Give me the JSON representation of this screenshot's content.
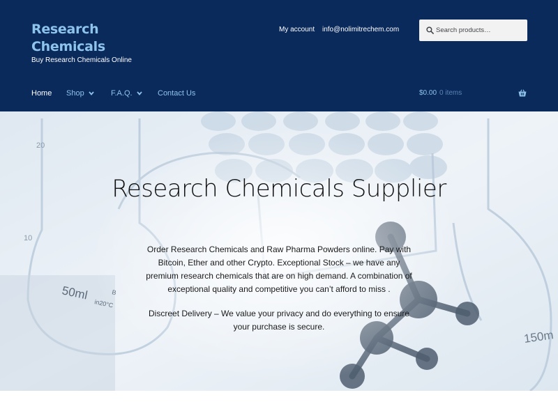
{
  "site": {
    "title": "Research Chemicals",
    "tagline": "Buy Research Chemicals Online"
  },
  "secondary_nav": {
    "account": "My account",
    "email": "info@nolimitrechem.com"
  },
  "search": {
    "placeholder": "Search products…",
    "icon": "search-icon"
  },
  "main_nav": {
    "items": [
      {
        "label": "Home",
        "active": true
      },
      {
        "label": "Shop",
        "has_dropdown": true
      },
      {
        "label": "F.A.Q.",
        "has_dropdown": true
      },
      {
        "label": "Contact Us"
      }
    ]
  },
  "cart": {
    "amount": "$0.00",
    "count": "0 items",
    "icon": "basket-icon"
  },
  "hero": {
    "title": "Research Chemicals Supplier",
    "paragraph1": "Order Research Chemicals and Raw Pharma Powders online. Pay with Bitcoin, Ether and other Crypto. Exceptional Stock – we have any premium research chemicals that are on high demand. A combination of exceptional quality and competitive you can’t afford to miss .",
    "paragraph2": "Discreet Delivery – We value your privacy and do everything to ensure your purchase is secure.",
    "image_text": {
      "beaker_volume": "50ml",
      "beaker_marking": "B",
      "beaker_temperature": "in20°C",
      "flask_volume": "150m",
      "graduation_20": "20",
      "graduation_10": "10"
    }
  },
  "colors": {
    "header_bg": "#0a2a5c",
    "title_color": "#8ec3ec",
    "nav_link": "#8ec3ec",
    "search_bg": "#f2f2f2"
  }
}
